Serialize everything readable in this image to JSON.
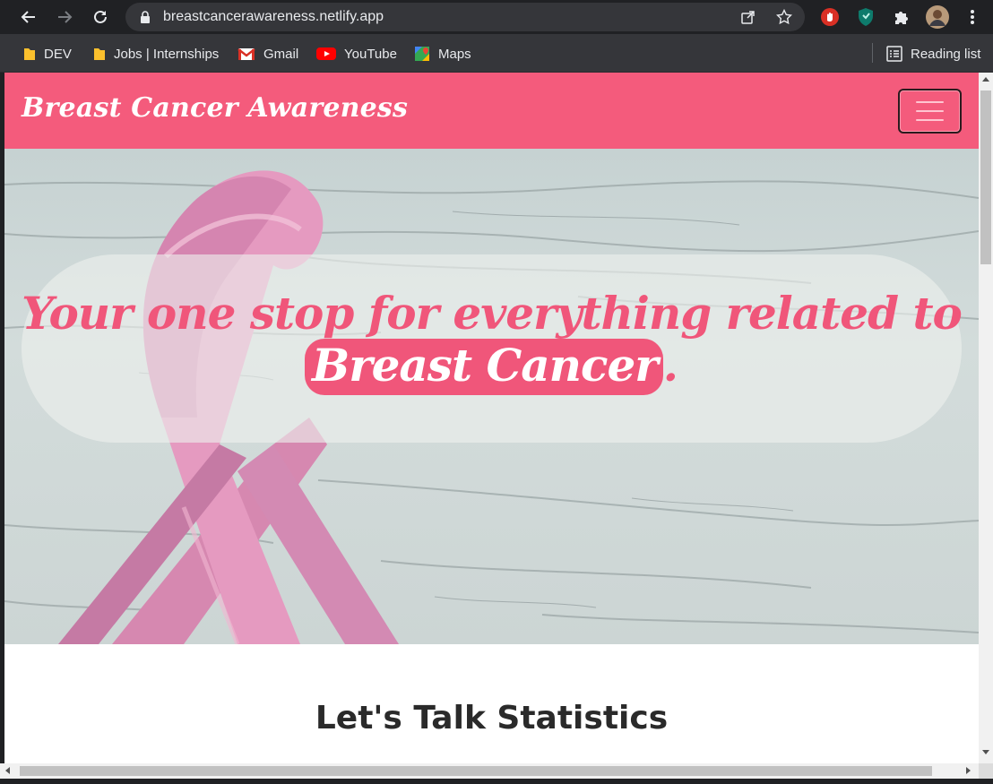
{
  "browser": {
    "url": "breastcancerawareness.netlify.app",
    "icons": [
      "back-icon",
      "forward-icon",
      "reload-icon",
      "lock-icon",
      "share-icon",
      "star-icon",
      "adblock-icon",
      "extension-shield-icon",
      "puzzle-icon",
      "profile-avatar",
      "kebab-menu-icon"
    ]
  },
  "bookmarks": {
    "items": [
      {
        "label": "DEV",
        "icon": "folder-icon"
      },
      {
        "label": "Jobs | Internships",
        "icon": "folder-icon"
      },
      {
        "label": "Gmail",
        "icon": "gmail-icon"
      },
      {
        "label": "YouTube",
        "icon": "youtube-icon"
      },
      {
        "label": "Maps",
        "icon": "maps-icon"
      }
    ],
    "reading_list": "Reading list"
  },
  "site": {
    "brand": "Breast Cancer Awareness",
    "accent": "#f45b7c",
    "hero": {
      "line1": "Your one stop for everything related to",
      "highlight": "Breast Cancer",
      "trailing": "."
    },
    "section_title": "Let's Talk Statistics"
  }
}
